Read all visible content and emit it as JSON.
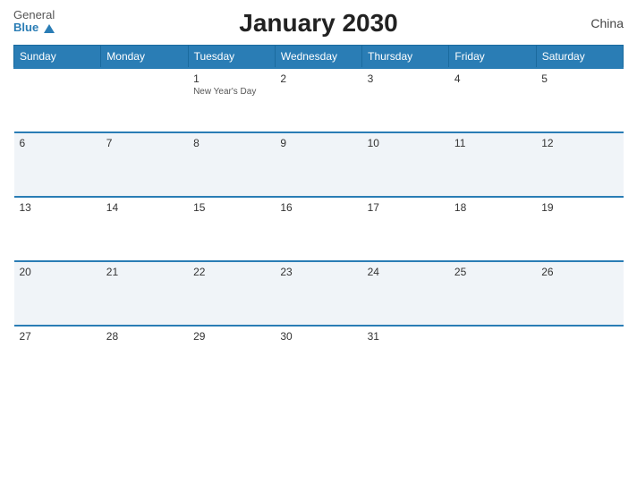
{
  "header": {
    "title": "January 2030",
    "country": "China",
    "logo_general": "General",
    "logo_blue": "Blue"
  },
  "weekdays": [
    "Sunday",
    "Monday",
    "Tuesday",
    "Wednesday",
    "Thursday",
    "Friday",
    "Saturday"
  ],
  "weeks": [
    [
      {
        "day": "",
        "holiday": ""
      },
      {
        "day": "",
        "holiday": ""
      },
      {
        "day": "1",
        "holiday": "New Year's Day"
      },
      {
        "day": "2",
        "holiday": ""
      },
      {
        "day": "3",
        "holiday": ""
      },
      {
        "day": "4",
        "holiday": ""
      },
      {
        "day": "5",
        "holiday": ""
      }
    ],
    [
      {
        "day": "6",
        "holiday": ""
      },
      {
        "day": "7",
        "holiday": ""
      },
      {
        "day": "8",
        "holiday": ""
      },
      {
        "day": "9",
        "holiday": ""
      },
      {
        "day": "10",
        "holiday": ""
      },
      {
        "day": "11",
        "holiday": ""
      },
      {
        "day": "12",
        "holiday": ""
      }
    ],
    [
      {
        "day": "13",
        "holiday": ""
      },
      {
        "day": "14",
        "holiday": ""
      },
      {
        "day": "15",
        "holiday": ""
      },
      {
        "day": "16",
        "holiday": ""
      },
      {
        "day": "17",
        "holiday": ""
      },
      {
        "day": "18",
        "holiday": ""
      },
      {
        "day": "19",
        "holiday": ""
      }
    ],
    [
      {
        "day": "20",
        "holiday": ""
      },
      {
        "day": "21",
        "holiday": ""
      },
      {
        "day": "22",
        "holiday": ""
      },
      {
        "day": "23",
        "holiday": ""
      },
      {
        "day": "24",
        "holiday": ""
      },
      {
        "day": "25",
        "holiday": ""
      },
      {
        "day": "26",
        "holiday": ""
      }
    ],
    [
      {
        "day": "27",
        "holiday": ""
      },
      {
        "day": "28",
        "holiday": ""
      },
      {
        "day": "29",
        "holiday": ""
      },
      {
        "day": "30",
        "holiday": ""
      },
      {
        "day": "31",
        "holiday": ""
      },
      {
        "day": "",
        "holiday": ""
      },
      {
        "day": "",
        "holiday": ""
      }
    ]
  ],
  "colors": {
    "header_bg": "#2a7db5",
    "blue": "#2a7db5"
  }
}
